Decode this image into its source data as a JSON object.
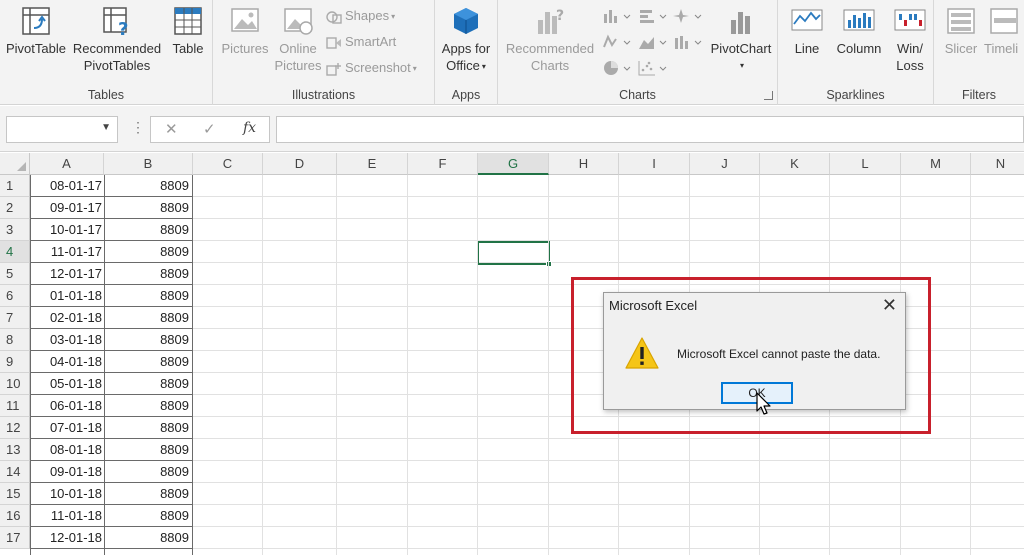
{
  "ribbon": {
    "tables": {
      "group_label": "Tables",
      "pivottable": "PivotTable",
      "recommended_l1": "Recommended",
      "recommended_l2": "PivotTables",
      "table": "Table"
    },
    "illustrations": {
      "group_label": "Illustrations",
      "pictures": "Pictures",
      "online_l1": "Online",
      "online_l2": "Pictures",
      "shapes": "Shapes",
      "smartart": "SmartArt",
      "screenshot": "Screenshot"
    },
    "apps": {
      "group_label": "Apps",
      "apps_l1": "Apps for",
      "apps_l2": "Office"
    },
    "charts": {
      "group_label": "Charts",
      "recommended_l1": "Recommended",
      "recommended_l2": "Charts",
      "pivotchart": "PivotChart"
    },
    "sparklines": {
      "group_label": "Sparklines",
      "line": "Line",
      "column": "Column",
      "winloss_l1": "Win/",
      "winloss_l2": "Loss"
    },
    "filters": {
      "group_label": "Filters",
      "slicer": "Slicer",
      "timeline": "Timeli"
    }
  },
  "formula_bar": {
    "name_box": "",
    "fx": "fx",
    "cancel": "✕",
    "enter": "✓",
    "formula": ""
  },
  "columns": [
    "A",
    "B",
    "C",
    "D",
    "E",
    "F",
    "G",
    "H",
    "I",
    "J",
    "K",
    "L",
    "M",
    "N"
  ],
  "selected_column": "G",
  "selected_row": "4",
  "rows": [
    {
      "n": "1",
      "a": "08-01-17",
      "b": "8809"
    },
    {
      "n": "2",
      "a": "09-01-17",
      "b": "8809"
    },
    {
      "n": "3",
      "a": "10-01-17",
      "b": "8809"
    },
    {
      "n": "4",
      "a": "11-01-17",
      "b": "8809"
    },
    {
      "n": "5",
      "a": "12-01-17",
      "b": "8809"
    },
    {
      "n": "6",
      "a": "01-01-18",
      "b": "8809"
    },
    {
      "n": "7",
      "a": "02-01-18",
      "b": "8809"
    },
    {
      "n": "8",
      "a": "03-01-18",
      "b": "8809"
    },
    {
      "n": "9",
      "a": "04-01-18",
      "b": "8809"
    },
    {
      "n": "10",
      "a": "05-01-18",
      "b": "8809"
    },
    {
      "n": "11",
      "a": "06-01-18",
      "b": "8809"
    },
    {
      "n": "12",
      "a": "07-01-18",
      "b": "8809"
    },
    {
      "n": "13",
      "a": "08-01-18",
      "b": "8809"
    },
    {
      "n": "14",
      "a": "09-01-18",
      "b": "8809"
    },
    {
      "n": "15",
      "a": "10-01-18",
      "b": "8809"
    },
    {
      "n": "16",
      "a": "11-01-18",
      "b": "8809"
    },
    {
      "n": "17",
      "a": "12-01-18",
      "b": "8809"
    }
  ],
  "dialog": {
    "title": "Microsoft Excel",
    "message": "Microsoft Excel cannot paste the data.",
    "ok_label": "OK",
    "close_glyph": "✕"
  },
  "colors": {
    "accent": "#217346",
    "highlight_box": "#c8202c",
    "ok_border": "#0078d7",
    "warning_fill": "#f5c518"
  }
}
